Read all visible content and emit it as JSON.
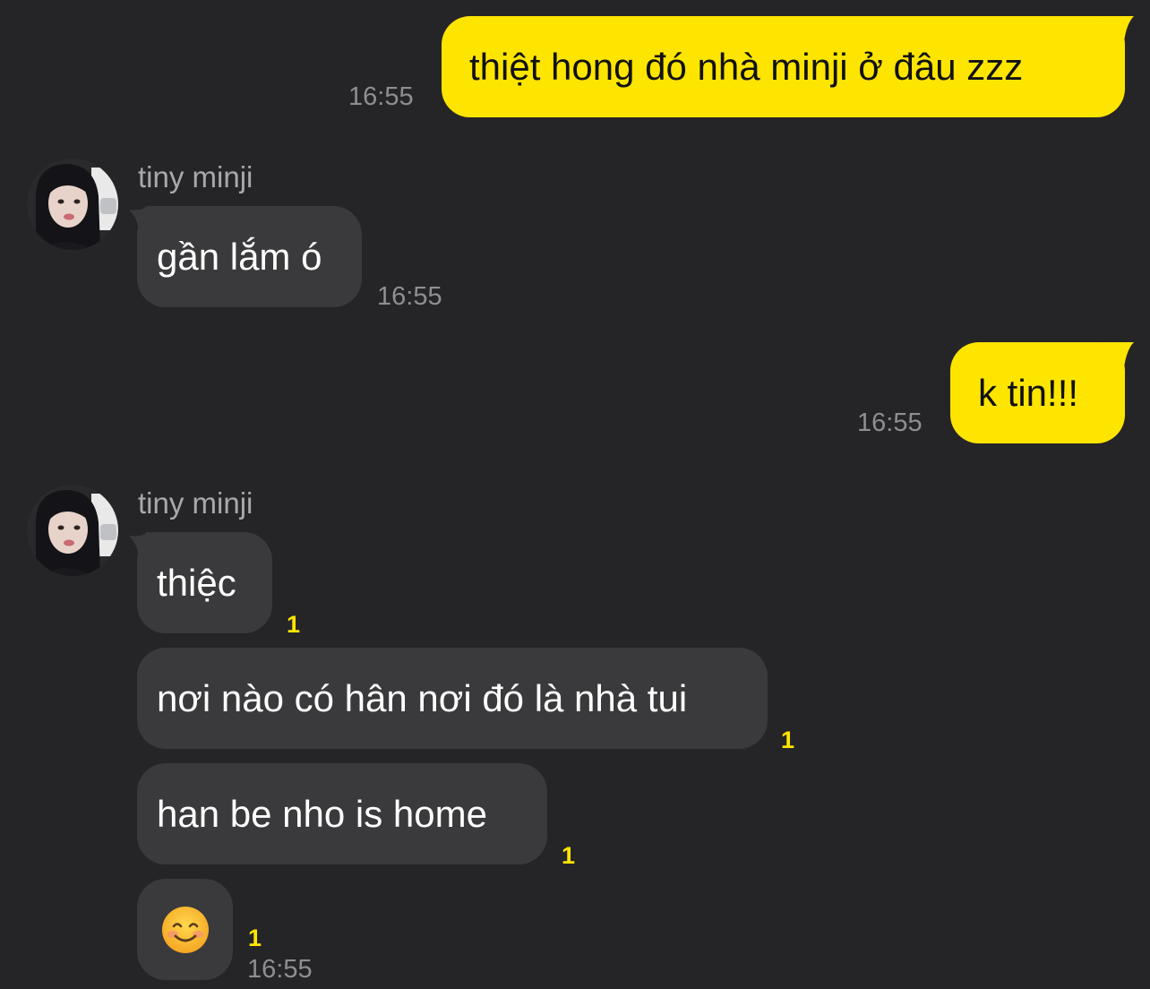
{
  "messages": {
    "m1": {
      "text": "thiệt hong đó nhà minji ở đâu zzz",
      "time": "16:55"
    },
    "m2": {
      "sender": "tiny minji",
      "text": "gần lắm ó",
      "time": "16:55"
    },
    "m3": {
      "text": "k tin!!!",
      "time": "16:55"
    },
    "m4": {
      "sender": "tiny minji",
      "bubbles": [
        {
          "text": "thiệc",
          "unread": "1"
        },
        {
          "text": "nơi nào có hân nơi đó là nhà tui",
          "unread": "1"
        },
        {
          "text": "han be nho is home",
          "unread": "1"
        },
        {
          "emoji": "😊",
          "unread": "1"
        }
      ],
      "time": "16:55"
    }
  },
  "colors": {
    "background": "#252527",
    "outgoing_bubble": "#fee500",
    "incoming_bubble": "#3a3a3c",
    "unread_count": "#fee500"
  },
  "icons": {
    "emoji": "smiling-face-emoji",
    "avatar": "contact-avatar"
  }
}
